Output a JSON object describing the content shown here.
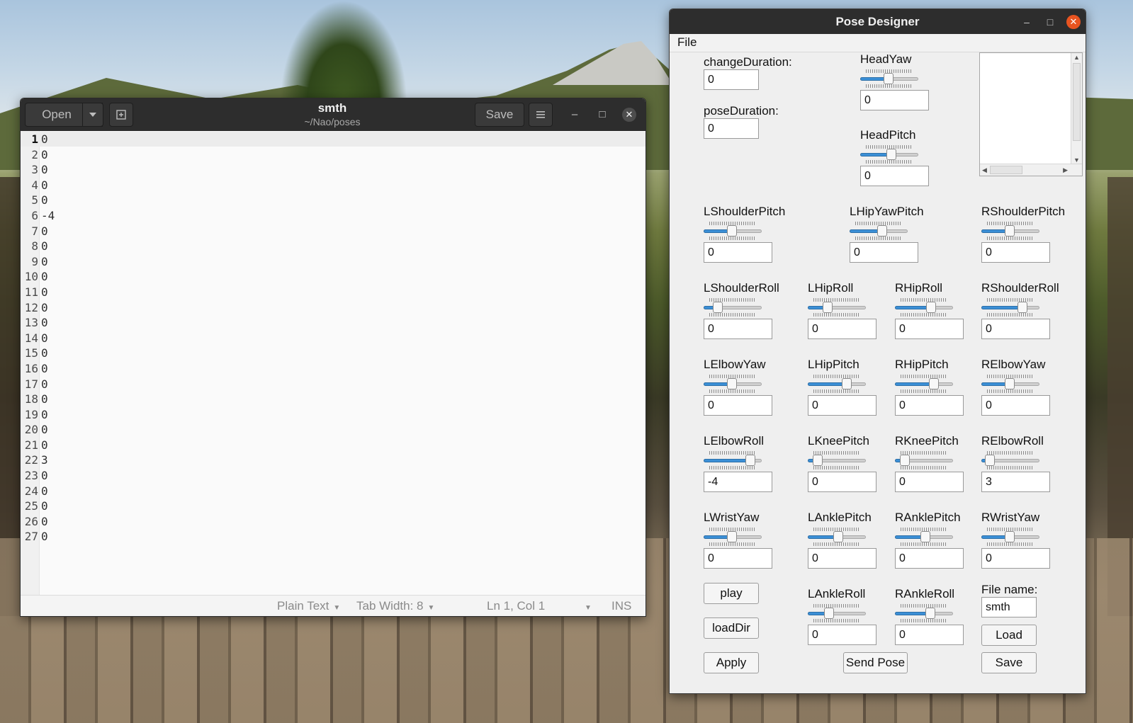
{
  "gedit": {
    "open_label": "Open",
    "save_label": "Save",
    "title": "smth",
    "subtitle": "~/Nao/poses",
    "lines": [
      {
        "n": "1",
        "t": "0"
      },
      {
        "n": "2",
        "t": "0"
      },
      {
        "n": "3",
        "t": "0"
      },
      {
        "n": "4",
        "t": "0"
      },
      {
        "n": "5",
        "t": "0"
      },
      {
        "n": "6",
        "t": "-4"
      },
      {
        "n": "7",
        "t": "0"
      },
      {
        "n": "8",
        "t": "0"
      },
      {
        "n": "9",
        "t": "0"
      },
      {
        "n": "10",
        "t": "0"
      },
      {
        "n": "11",
        "t": "0"
      },
      {
        "n": "12",
        "t": "0"
      },
      {
        "n": "13",
        "t": "0"
      },
      {
        "n": "14",
        "t": "0"
      },
      {
        "n": "15",
        "t": "0"
      },
      {
        "n": "16",
        "t": "0"
      },
      {
        "n": "17",
        "t": "0"
      },
      {
        "n": "18",
        "t": "0"
      },
      {
        "n": "19",
        "t": "0"
      },
      {
        "n": "20",
        "t": "0"
      },
      {
        "n": "21",
        "t": "0"
      },
      {
        "n": "22",
        "t": "3"
      },
      {
        "n": "23",
        "t": "0"
      },
      {
        "n": "24",
        "t": "0"
      },
      {
        "n": "25",
        "t": "0"
      },
      {
        "n": "26",
        "t": "0"
      },
      {
        "n": "27",
        "t": "0"
      }
    ],
    "status": {
      "language": "Plain Text",
      "tab_width": "Tab Width: 8",
      "position": "Ln 1, Col 1",
      "mode": "INS"
    }
  },
  "pose": {
    "title": "Pose Designer",
    "menu_file": "File",
    "change_duration_label": "changeDuration:",
    "change_duration_value": "0",
    "pose_duration_label": "poseDuration:",
    "pose_duration_value": "0",
    "file_name_label": "File name:",
    "file_name_value": "smth",
    "buttons": {
      "play": "play",
      "loadDir": "loadDir",
      "apply": "Apply",
      "send_pose": "Send Pose",
      "load": "Load",
      "save": "Save"
    },
    "joints": {
      "HeadYaw": {
        "label": "HeadYaw",
        "value": "0",
        "level": 0.5
      },
      "HeadPitch": {
        "label": "HeadPitch",
        "value": "0",
        "level": 0.56
      },
      "LShoulderPitch": {
        "label": "LShoulderPitch",
        "value": "0",
        "level": 0.5
      },
      "LHipYawPitch": {
        "label": "LHipYawPitch",
        "value": "0",
        "level": 0.59
      },
      "RShoulderPitch": {
        "label": "RShoulderPitch",
        "value": "0",
        "level": 0.5
      },
      "LShoulderRoll": {
        "label": "LShoulderRoll",
        "value": "0",
        "level": 0.2
      },
      "LHipRoll": {
        "label": "LHipRoll",
        "value": "0",
        "level": 0.32
      },
      "RHipRoll": {
        "label": "RHipRoll",
        "value": "0",
        "level": 0.66
      },
      "RShoulderRoll": {
        "label": "RShoulderRoll",
        "value": "0",
        "level": 0.78
      },
      "LElbowYaw": {
        "label": "LElbowYaw",
        "value": "0",
        "level": 0.5
      },
      "LHipPitch": {
        "label": "LHipPitch",
        "value": "0",
        "level": 0.72
      },
      "RHipPitch": {
        "label": "RHipPitch",
        "value": "0",
        "level": 0.72
      },
      "RElbowYaw": {
        "label": "RElbowYaw",
        "value": "0",
        "level": 0.5
      },
      "LElbowRoll": {
        "label": "LElbowRoll",
        "value": "-4",
        "level": 0.9
      },
      "LKneePitch": {
        "label": "LKneePitch",
        "value": "0",
        "level": 0.1
      },
      "RKneePitch": {
        "label": "RKneePitch",
        "value": "0",
        "level": 0.1
      },
      "RElbowRoll": {
        "label": "RElbowRoll",
        "value": "3",
        "level": 0.08
      },
      "LWristYaw": {
        "label": "LWristYaw",
        "value": "0",
        "level": 0.5
      },
      "LAnklePitch": {
        "label": "LAnklePitch",
        "value": "0",
        "level": 0.55
      },
      "RAnklePitch": {
        "label": "RAnklePitch",
        "value": "0",
        "level": 0.55
      },
      "RWristYaw": {
        "label": "RWristYaw",
        "value": "0",
        "level": 0.5
      },
      "LAnkleRoll": {
        "label": "LAnkleRoll",
        "value": "0",
        "level": 0.35
      },
      "RAnkleRoll": {
        "label": "RAnkleRoll",
        "value": "0",
        "level": 0.65
      }
    }
  }
}
